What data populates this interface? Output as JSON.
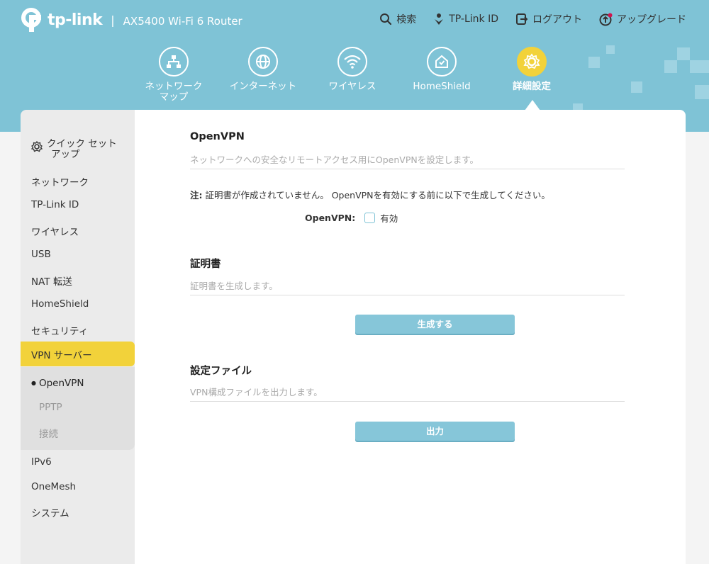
{
  "header": {
    "brand": "tp-link",
    "separator": "|",
    "model": "AX5400 Wi-Fi 6 Router",
    "links": [
      {
        "label": "検索",
        "icon": "search-icon"
      },
      {
        "label": "TP-Link ID",
        "icon": "tplink-id-icon"
      },
      {
        "label": "ログアウト",
        "icon": "logout-icon"
      },
      {
        "label": "アップグレード",
        "icon": "upgrade-icon"
      }
    ]
  },
  "nav": {
    "items": [
      {
        "label_line1": "ネットワーク",
        "label_line2": "マップ",
        "icon": "network-map-icon"
      },
      {
        "label": "インターネット",
        "icon": "globe-icon"
      },
      {
        "label": "ワイヤレス",
        "icon": "wifi-icon"
      },
      {
        "label": "HomeShield",
        "icon": "homeshield-icon"
      },
      {
        "label": "詳細設定",
        "icon": "gear-icon",
        "active": true
      }
    ]
  },
  "sidebar": {
    "quick_setup_line1": "クイック セット",
    "quick_setup_line2": "アップ",
    "items": [
      "ネットワーク",
      "TP-Link ID",
      "ワイヤレス",
      "USB",
      "NAT 転送",
      "HomeShield",
      "セキュリティ",
      "VPN サーバー"
    ],
    "sub_items": [
      "OpenVPN",
      "PPTP",
      "接続"
    ],
    "bullet": "●",
    "bottom_items": [
      "IPv6",
      "OneMesh",
      "システム"
    ]
  },
  "main": {
    "openvpn": {
      "title": "OpenVPN",
      "desc": "ネットワークへの安全なリモートアクセス用にOpenVPNを設定します。",
      "note_label": "注:",
      "note_text": " 証明書が作成されていません。 OpenVPNを有効にする前に以下で生成してください。",
      "toggle_label": "OpenVPN:",
      "enable_label": "有効",
      "enabled": false
    },
    "certificate": {
      "title": "証明書",
      "desc": "証明書を生成します。",
      "button": "生成する"
    },
    "config": {
      "title": "設定ファイル",
      "desc": "VPN構成ファイルを出力します。",
      "button": "出力"
    }
  },
  "colors": {
    "header_bg": "#7fc3d6",
    "accent": "#f2d23a",
    "button": "#86c6d9"
  }
}
